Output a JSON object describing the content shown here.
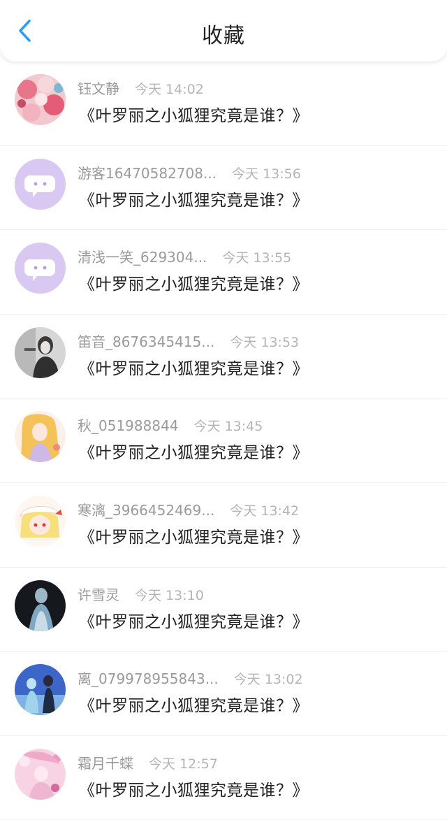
{
  "header": {
    "title": "收藏"
  },
  "items": [
    {
      "name": "钰文静",
      "time": "今天 14:02",
      "text": "《叶罗丽之小狐狸究竟是谁？》",
      "avatar": "flowers"
    },
    {
      "name": "游客16470582708...",
      "time": "今天 13:56",
      "text": "《叶罗丽之小狐狸究竟是谁？》",
      "avatar": "default"
    },
    {
      "name": "清浅一笑_629304...",
      "time": "今天 13:55",
      "text": "《叶罗丽之小狐狸究竟是谁？》",
      "avatar": "default"
    },
    {
      "name": "笛音_8676345415...",
      "time": "今天 13:53",
      "text": "《叶罗丽之小狐狸究竟是谁？》",
      "avatar": "sketch"
    },
    {
      "name": "秋_051988844",
      "time": "今天 13:45",
      "text": "《叶罗丽之小狐狸究竟是谁？》",
      "avatar": "anime-gold"
    },
    {
      "name": "寒漓_3966452469...",
      "time": "今天 13:42",
      "text": "《叶罗丽之小狐狸究竟是谁？》",
      "avatar": "anime-blonde"
    },
    {
      "name": "许雪灵",
      "time": "今天 13:10",
      "text": "《叶罗丽之小狐狸究竟是谁？》",
      "avatar": "dark-figure"
    },
    {
      "name": "离_079978955843...",
      "time": "今天 13:02",
      "text": "《叶罗丽之小狐狸究竟是谁？》",
      "avatar": "couple"
    },
    {
      "name": "霜月千蝶",
      "time": "今天 12:57",
      "text": "《叶罗丽之小狐狸究竟是谁？》",
      "avatar": "pink-girl"
    }
  ]
}
